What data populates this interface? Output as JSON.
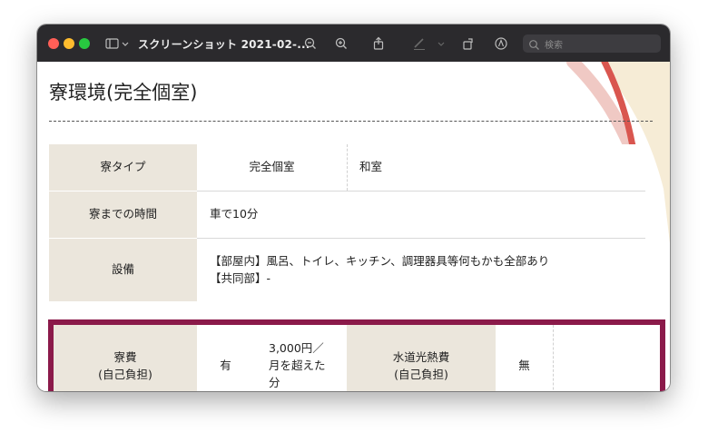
{
  "window": {
    "title": "スクリーンショット 2021-02-...",
    "search_placeholder": "検索"
  },
  "page": {
    "title": "寮環境(完全個室)"
  },
  "table": {
    "room_type_label": "寮タイプ",
    "room_type_value": "完全個室",
    "room_style_value": "和室",
    "commute_label": "寮までの時間",
    "commute_value": "車で10分",
    "facilities_label": "設備",
    "facilities_line1": "【部屋内】風呂、トイレ、キッチン、調理器具等何もかも全部あり",
    "facilities_line2": "【共同部】-",
    "rent_label_line1": "寮費",
    "rent_label_line2": "(自己負担)",
    "rent_value": "有",
    "rent_note_line1": "3,000円／",
    "rent_note_line2": "月を超えた",
    "rent_note_line3": "分",
    "utilities_label_line1": "水道光熱費",
    "utilities_label_line2": "(自己負担)",
    "utilities_value": "無"
  },
  "colors": {
    "header_cell": "#ebe6dc",
    "highlight_border": "#8b1a4a",
    "titlebar": "#2b2a2d"
  }
}
